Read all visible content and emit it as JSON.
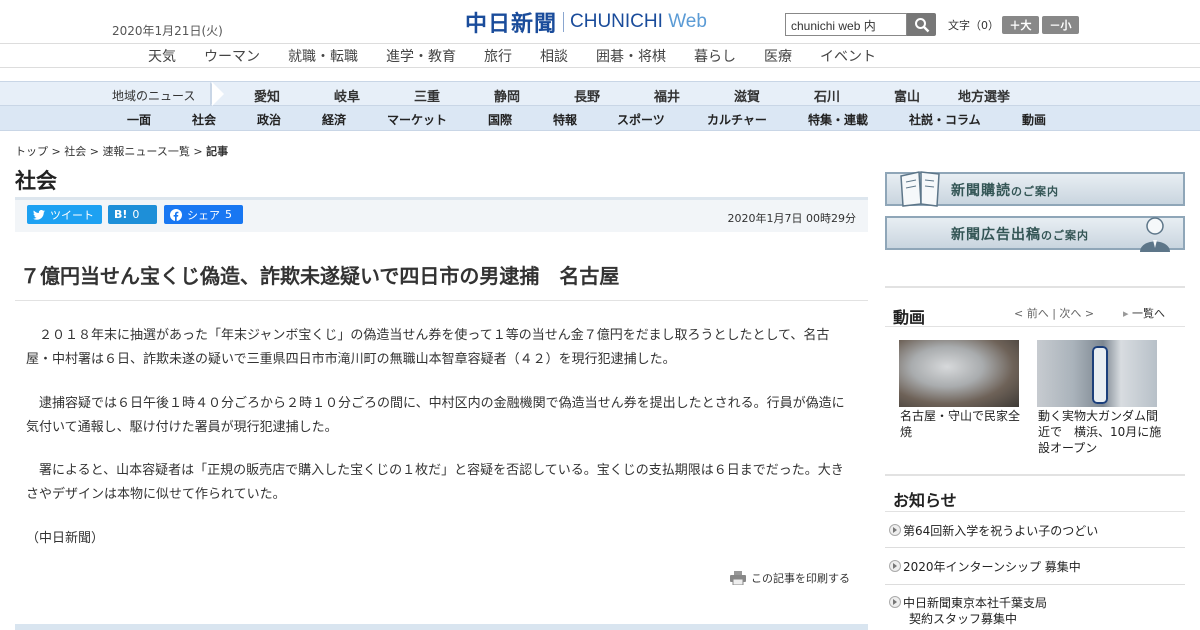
{
  "header": {
    "date": "2020年1月21日(火)",
    "logo_jp": "中日新聞",
    "logo_en": "CHUNICHI",
    "logo_web": "Web",
    "search_value": "chunichi web 内",
    "font_size_label": "文字（0）",
    "font_up": "＋大",
    "font_down": "－小"
  },
  "nav_top": [
    "天気",
    "ウーマン",
    "就職・転職",
    "進学・教育",
    "旅行",
    "相談",
    "囲碁・将棋",
    "暮らし",
    "医療",
    "イベント"
  ],
  "nav_region": {
    "label": "地域のニュース",
    "items": [
      "愛知",
      "岐阜",
      "三重",
      "静岡",
      "長野",
      "福井",
      "滋賀",
      "石川",
      "富山",
      "地方選挙"
    ]
  },
  "nav_category": [
    "一面",
    "社会",
    "政治",
    "経済",
    "マーケット",
    "国際",
    "特報",
    "スポーツ",
    "カルチャー",
    "特集・連載",
    "社説・コラム",
    "動画"
  ],
  "breadcrumb": {
    "top": "トップ",
    "sep": " > ",
    "society": "社会",
    "list": "速報ニュース一覧",
    "current": "記事"
  },
  "section_title": "社会",
  "share": {
    "tweet": "ツイート",
    "hatena_label": "B!",
    "hatena_count": "0",
    "facebook": "シェア",
    "facebook_count": "5",
    "datetime": "2020年1月7日 00時29分"
  },
  "article": {
    "title": "７億円当せん宝くじ偽造、詐欺未遂疑いで四日市の男逮捕　名古屋",
    "paragraphs": [
      "　２０１８年末に抽選があった「年末ジャンボ宝くじ」の偽造当せん券を使って１等の当せん金７億円をだまし取ろうとしたとして、名古屋・中村署は６日、詐欺未遂の疑いで三重県四日市市滝川町の無職山本智章容疑者（４２）を現行犯逮捕した。",
      "　逮捕容疑では６日午後１時４０分ごろから２時１０分ごろの間に、中村区内の金融機関で偽造当せん券を提出したとされる。行員が偽造に気付いて通報し、駆け付けた署員が現行犯逮捕した。",
      "　署によると、山本容疑者は「正規の販売店で購入した宝くじの１枚だ」と容疑を否認している。宝くじの支払期限は６日までだった。大きさやデザインは本物に似せて作られていた。",
      "（中日新聞）"
    ],
    "print_label": "この記事を印刷する"
  },
  "sidebar": {
    "banner_subscribe": "新聞購読",
    "banner_subscribe_sub": "のご案内",
    "banner_ad": "新聞広告出稿",
    "banner_ad_sub": "のご案内",
    "video_heading": "動画",
    "video_nav": "< 前へ | 次へ >",
    "video_all": "一覧へ",
    "videos": [
      {
        "caption": "名古屋・守山で民家全焼"
      },
      {
        "caption": "動く実物大ガンダム間近で　横浜、10月に施設オープン"
      }
    ],
    "notice_heading": "お知らせ",
    "notices": [
      "第64回新入学を祝うよい子のつどい",
      "2020年インターンシップ 募集中",
      "中日新聞東京本社千葉支局",
      "契約スタッフ募集中"
    ]
  },
  "colors": {
    "brand": "#1a4c9b",
    "twitter": "#1da1f2",
    "hatena": "#1e8fd8",
    "facebook": "#1877f2"
  }
}
